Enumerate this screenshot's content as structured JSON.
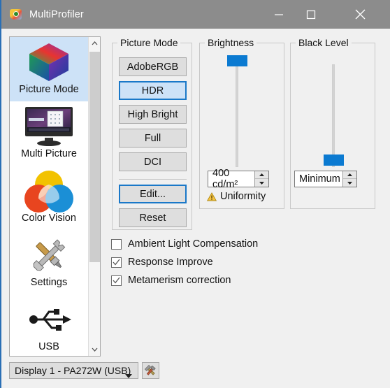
{
  "window": {
    "title": "MultiProfiler",
    "app_icon": "multiprofiler-app-icon",
    "minimize_label": "—",
    "maximize_label": "□",
    "close_label": "✕",
    "background_color": "#f0f0f0",
    "titlebar_color": "#8c8c8c",
    "accent_color": "#1a78c8"
  },
  "sidebar": {
    "items": [
      {
        "label": "Picture Mode",
        "icon": "color-cube-icon",
        "selected": true
      },
      {
        "label": "Multi Picture",
        "icon": "monitor-icon",
        "selected": false
      },
      {
        "label": "Color Vision",
        "icon": "color-circles-icon",
        "selected": false
      },
      {
        "label": "Settings",
        "icon": "wrench-screwdriver-icon",
        "selected": false
      },
      {
        "label": "USB",
        "icon": "usb-icon",
        "selected": false
      }
    ],
    "scroll_up_icon": "chevron-up-icon",
    "scroll_down_icon": "chevron-down-icon"
  },
  "picture_mode": {
    "title": "Picture Mode",
    "modes": [
      {
        "label": "AdobeRGB",
        "state": "normal"
      },
      {
        "label": "HDR",
        "state": "selected"
      },
      {
        "label": "High Bright",
        "state": "normal"
      },
      {
        "label": "Full",
        "state": "normal"
      },
      {
        "label": "DCI",
        "state": "normal"
      }
    ],
    "edit_label": "Edit...",
    "edit_state": "focused",
    "reset_label": "Reset"
  },
  "brightness": {
    "title": "Brightness",
    "value": "400 cd/m²",
    "slider_percent": 96,
    "uniformity_label": "Uniformity",
    "uniformity_icon": "warning-triangle-icon",
    "spin_up_icon": "spinner-up-icon",
    "spin_down_icon": "spinner-down-icon"
  },
  "black_level": {
    "title": "Black Level",
    "value": "Minimum",
    "slider_percent": 4,
    "spin_up_icon": "spinner-up-icon",
    "spin_down_icon": "spinner-down-icon"
  },
  "options": [
    {
      "label": "Ambient Light Compensation",
      "checked": false
    },
    {
      "label": "Response Improve",
      "checked": true
    },
    {
      "label": "Metamerism correction",
      "checked": true
    }
  ],
  "footer": {
    "display_value": "Display 1 - PA272W (USB)",
    "dropdown_icon": "chevron-down-icon",
    "tools_icon": "hammer-wrench-icon"
  }
}
